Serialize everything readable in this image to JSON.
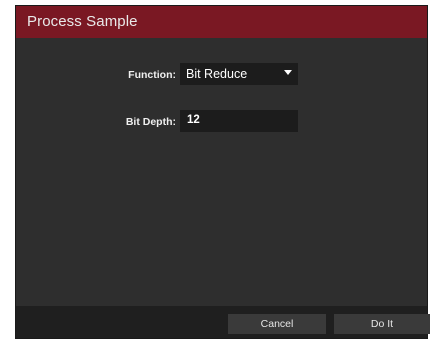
{
  "dialog": {
    "title": "Process Sample"
  },
  "form": {
    "function_label": "Function:",
    "function_value": "Bit Reduce",
    "bit_depth_label": "Bit Depth:",
    "bit_depth_value": "12"
  },
  "footer": {
    "cancel_label": "Cancel",
    "do_it_label": "Do It"
  },
  "icons": {
    "dropdown": "chevron-down-icon"
  },
  "colors": {
    "titlebar": "#7a1823",
    "background": "#2e2e2e",
    "field": "#1c1c1c",
    "footer": "#1f1f1f"
  }
}
